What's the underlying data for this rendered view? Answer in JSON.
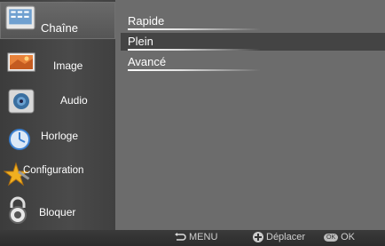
{
  "sidebar": {
    "items": [
      {
        "label": "Chaîne",
        "icon": "channel-icon",
        "active": true
      },
      {
        "label": "Image",
        "icon": "picture-icon"
      },
      {
        "label": "Audio",
        "icon": "speaker-icon"
      },
      {
        "label": "Horloge",
        "icon": "clock-icon"
      },
      {
        "label": "Configuration",
        "icon": "star-tools-icon"
      },
      {
        "label": "Bloquer",
        "icon": "lock-icon"
      }
    ]
  },
  "menu": {
    "items": [
      {
        "label": "Rapide"
      },
      {
        "label": "Plein",
        "selected": true
      },
      {
        "label": "Avancé"
      }
    ]
  },
  "footer": {
    "menu_label": "MENU",
    "move_label": "Déplacer",
    "ok_badge": "OK",
    "ok_label": "OK"
  }
}
